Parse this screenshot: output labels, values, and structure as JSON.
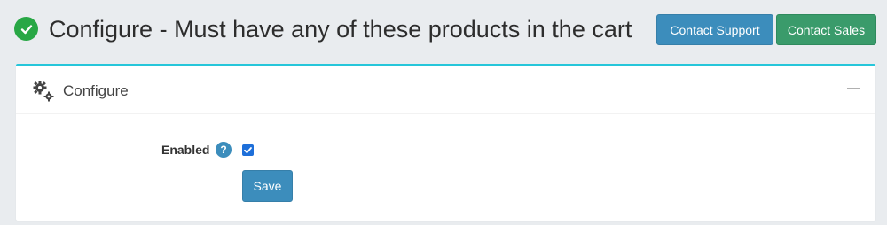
{
  "header": {
    "status_icon": "check-circle-icon",
    "title": "Configure - Must have any of these products in the cart",
    "contact_support_label": "Contact Support",
    "contact_sales_label": "Contact Sales"
  },
  "card": {
    "icon": "gears-icon",
    "title": "Configure",
    "collapse_icon": "minus-icon",
    "accent_color": "#26c6da"
  },
  "form": {
    "enabled_label": "Enabled",
    "help_glyph": "?",
    "enabled_checked": true,
    "save_label": "Save"
  },
  "colors": {
    "primary": "#3c8dbc",
    "success": "#3a9b6b",
    "status_green": "#28a745"
  }
}
